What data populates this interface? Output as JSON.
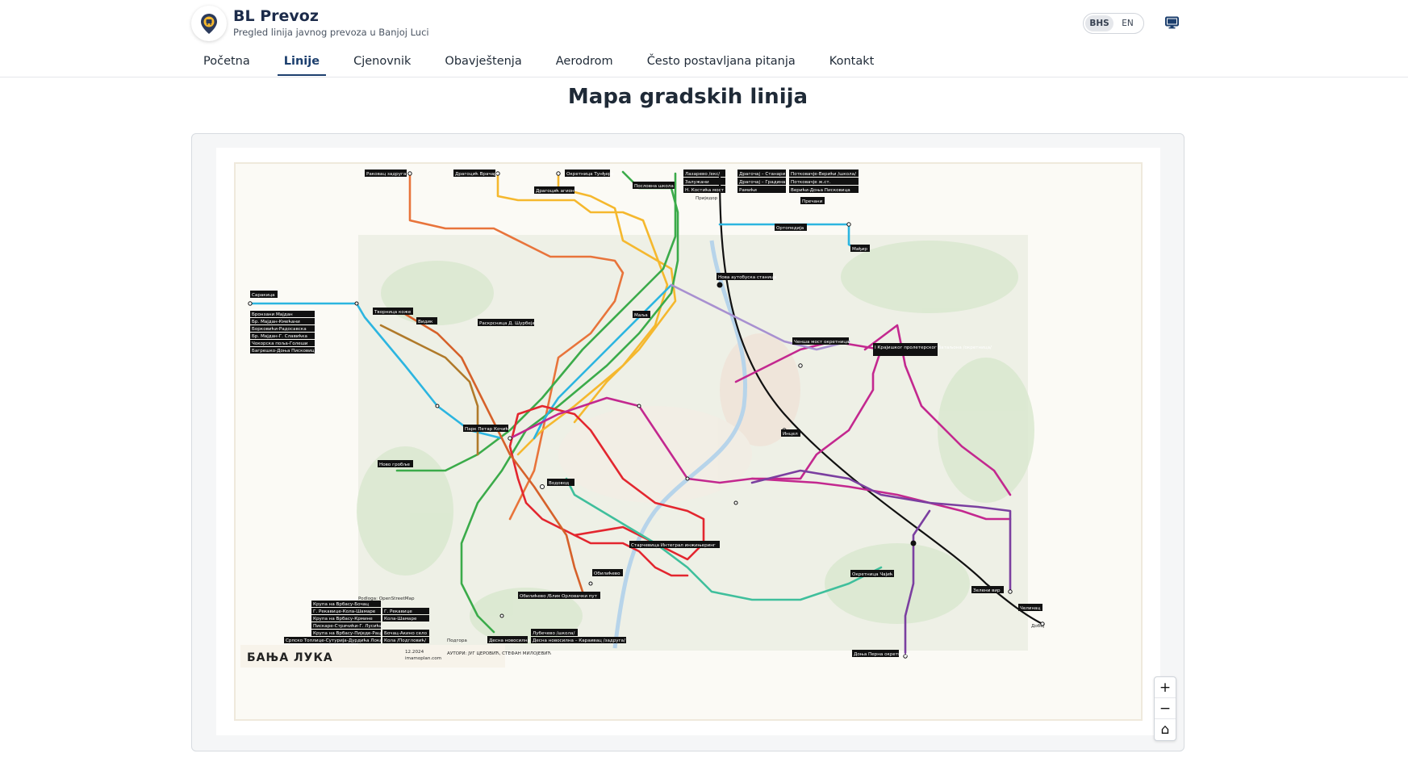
{
  "brand": {
    "title": "BL Prevoz",
    "subtitle": "Pregled linija javnog prevoza u Banjoj Luci",
    "logo_icon": "map-pin-bus-icon"
  },
  "language": {
    "options": [
      "BHS",
      "EN"
    ],
    "selected": "BHS"
  },
  "display_icon": "monitor-icon",
  "nav": {
    "items": [
      {
        "label": "Početna",
        "active": false
      },
      {
        "label": "Linije",
        "active": true
      },
      {
        "label": "Cjenovnik",
        "active": false
      },
      {
        "label": "Obavještenja",
        "active": false
      },
      {
        "label": "Aerodrom",
        "active": false
      },
      {
        "label": "Često postavljana pitanja",
        "active": false
      },
      {
        "label": "Kontakt",
        "active": false
      }
    ]
  },
  "page": {
    "title": "Mapa gradskih linija"
  },
  "map": {
    "city_name": "БАЊА ЛУКА",
    "credit": "Podloga: OpenStreetMap",
    "footer_date": "12.2024",
    "footer_site": "imamoplan.com",
    "footer_authors": "АУТОРИ: ЈУГ ЦЕРОВИЋ, СТЕФАН МИЛОЈЕВИЋ",
    "colors": {
      "orange": "#e8743b",
      "yellow": "#f5b82e",
      "green": "#3bab4a",
      "blue": "#2cb5e0",
      "red": "#e3262f",
      "magenta": "#c3288f",
      "purple": "#7b3fa0",
      "teal": "#3fbf9c",
      "black": "#111111",
      "brown": "#b07a2a",
      "lilac": "#a890d0"
    },
    "terminals": [
      "Раковац задруга",
      "Драгоцић Врачар",
      "Окретница Тунђеро",
      "Лазарево /екс/",
      "Залужани",
      "Н. Костића мост",
      "Драгочај – Станари",
      "Драгочај – Градина",
      "Рамићи",
      "Потковачје-Верићи /школа/",
      "Потковачје ж.ст.",
      "Верићи-Доња Писковица",
      "Пословна школа",
      "Драгоцић агион",
      "Приједор",
      "Пречани",
      "Ортопедија",
      "Мађир",
      "Саракица",
      "Бронзани Мајдан",
      "Бр. Мајдан-Кмећани",
      "Борковићи-Радосавска",
      "Бр. Мајдан-Г. Славићка",
      "Чокорска поља-Голеши",
      "Багрешко-Доња Писковица",
      "Творница коже",
      "Видик",
      "Раскрсница Д. Шурбеја",
      "Нова аутобуска станица",
      "Маља",
      "Ченша мост окретница",
      "I Крајишког пролетерског батаљона /окретница/",
      "Парк Петар Кочић",
      "Ново гробље",
      "Водовод",
      "Инцел",
      "Старчевица Интеграл инжињеринг",
      "Обилићево",
      "Обилићево /Блик/",
      "Орловачки пут",
      "Окретница Чајић",
      "Зелени вир",
      "Челинац",
      "Добој",
      "Доња Перна окретница",
      "Лубечево /школа/",
      "Десна новосилна",
      "Крупа на Врбасу-Бочац",
      "Г. Рекавице-Кола-Шамаре",
      "Крупа на Врбасу-Крмине",
      "Пискаре-Стричићи-Г. Лусићи",
      "Крупа на Врбасу-Пиједе-Рацићи",
      "Српско Топлице-Сутурија-Дурдића Локаи",
      "Г. Рекавице",
      "Кола-Шамаре",
      "Бочац-Акино село",
      "Кола /Подгловић/",
      "Подгора",
      "Десна новосилна – Караивац /задруга/"
    ]
  },
  "zoom_controls": [
    {
      "name": "zoom-in-button",
      "icon": "plus-icon",
      "label": "+"
    },
    {
      "name": "zoom-out-button",
      "icon": "minus-icon",
      "label": "−"
    },
    {
      "name": "home-button",
      "icon": "home-icon",
      "label": "⌂"
    }
  ]
}
